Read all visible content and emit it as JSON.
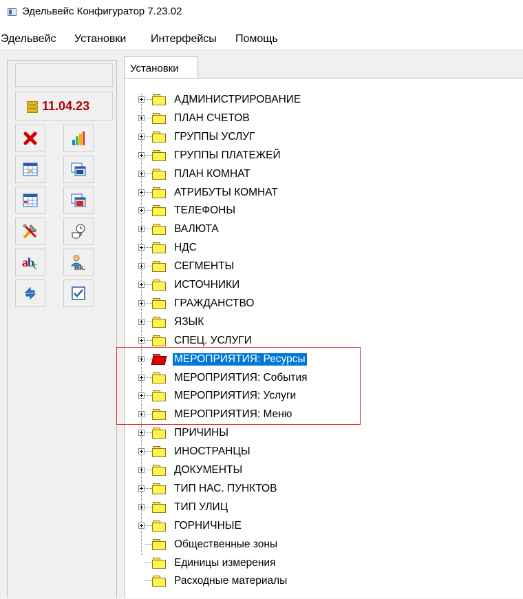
{
  "window": {
    "title": "Эдельвейс Конфигуратор 7.23.02"
  },
  "menu": [
    "Эдельвейс",
    "Установки",
    "Интерфейсы",
    "Помощь"
  ],
  "sidebar": {
    "date": "11.04.23",
    "buttons": [
      {
        "name": "delete-icon"
      },
      {
        "name": "chart-icon"
      },
      {
        "name": "grid-icon"
      },
      {
        "name": "grid-stack-icon"
      },
      {
        "name": "grid-2-icon"
      },
      {
        "name": "grid-red-icon"
      },
      {
        "name": "tools-icon"
      },
      {
        "name": "cup-clock-icon"
      },
      {
        "name": "abc-icon"
      },
      {
        "name": "user-mk-icon"
      },
      {
        "name": "refresh-icon"
      },
      {
        "name": "checklist-icon"
      }
    ]
  },
  "tab": {
    "label": "Установки"
  },
  "tree": {
    "items": [
      {
        "label": "АДМИНИСТРИРОВАНИЕ",
        "expandable": true
      },
      {
        "label": "ПЛАН СЧЕТОВ",
        "expandable": true
      },
      {
        "label": "ГРУППЫ УСЛУГ",
        "expandable": true
      },
      {
        "label": "ГРУППЫ ПЛАТЕЖЕЙ",
        "expandable": true
      },
      {
        "label": "ПЛАН КОМНАТ",
        "expandable": true
      },
      {
        "label": "АТРИБУТЫ КОМНАТ",
        "expandable": true
      },
      {
        "label": "ТЕЛЕФОНЫ",
        "expandable": true
      },
      {
        "label": "ВАЛЮТА",
        "expandable": true
      },
      {
        "label": "НДС",
        "expandable": true
      },
      {
        "label": "СЕГМЕНТЫ",
        "expandable": true
      },
      {
        "label": "ИСТОЧНИКИ",
        "expandable": true
      },
      {
        "label": "ГРАЖДАНСТВО",
        "expandable": true
      },
      {
        "label": "ЯЗЫК",
        "expandable": true
      },
      {
        "label": "СПЕЦ. УСЛУГИ",
        "expandable": true
      },
      {
        "label": "МЕРОПРИЯТИЯ: Ресурсы",
        "expandable": true,
        "selected": true
      },
      {
        "label": "МЕРОПРИЯТИЯ: События",
        "expandable": true
      },
      {
        "label": "МЕРОПРИЯТИЯ: Услуги",
        "expandable": true
      },
      {
        "label": "МЕРОПРИЯТИЯ: Меню",
        "expandable": true
      },
      {
        "label": "ПРИЧИНЫ",
        "expandable": true
      },
      {
        "label": "ИНОСТРАНЦЫ",
        "expandable": true
      },
      {
        "label": "ДОКУМЕНТЫ",
        "expandable": true
      },
      {
        "label": "ТИП НАС. ПУНКТОВ",
        "expandable": true
      },
      {
        "label": "ТИП УЛИЦ",
        "expandable": true
      },
      {
        "label": "ГОРНИЧНЫЕ",
        "expandable": true
      },
      {
        "label": "Общественные зоны",
        "expandable": false
      },
      {
        "label": "Единицы измерения",
        "expandable": false
      },
      {
        "label": "Расходные материалы",
        "expandable": false
      }
    ]
  },
  "colors": {
    "selection": "#0078d7",
    "highlight_box": "#e03030",
    "date_text": "#b00000"
  }
}
